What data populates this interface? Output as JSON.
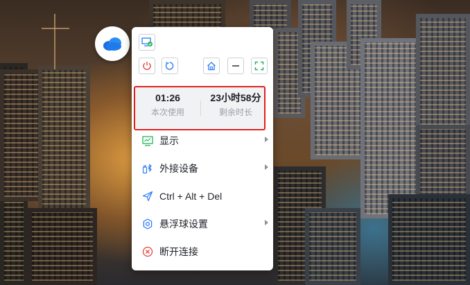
{
  "toolbar": {
    "icons": [
      "monitor-check-icon",
      "power-icon",
      "refresh-icon",
      "home-icon",
      "minimize-icon",
      "fullscreen-icon"
    ]
  },
  "session": {
    "used_value": "01:26",
    "used_label": "本次使用",
    "remaining_value": "23小时58分",
    "remaining_label": "剩余时长"
  },
  "menu": {
    "items": [
      {
        "label": "显示",
        "icon": "monitor-chart-icon",
        "has_submenu": true
      },
      {
        "label": "外接设备",
        "icon": "devices-icon",
        "has_submenu": true
      },
      {
        "label": "Ctrl + Alt + Del",
        "icon": "send-icon",
        "has_submenu": false
      },
      {
        "label": "悬浮球设置",
        "icon": "settings-icon",
        "has_submenu": true
      },
      {
        "label": "断开连接",
        "icon": "disconnect-icon",
        "has_submenu": false
      }
    ]
  },
  "colors": {
    "accent_blue": "#2b7cf6",
    "power_red": "#e5473c",
    "fullscreen_green": "#26b35a",
    "highlight_red": "#e0201c"
  }
}
